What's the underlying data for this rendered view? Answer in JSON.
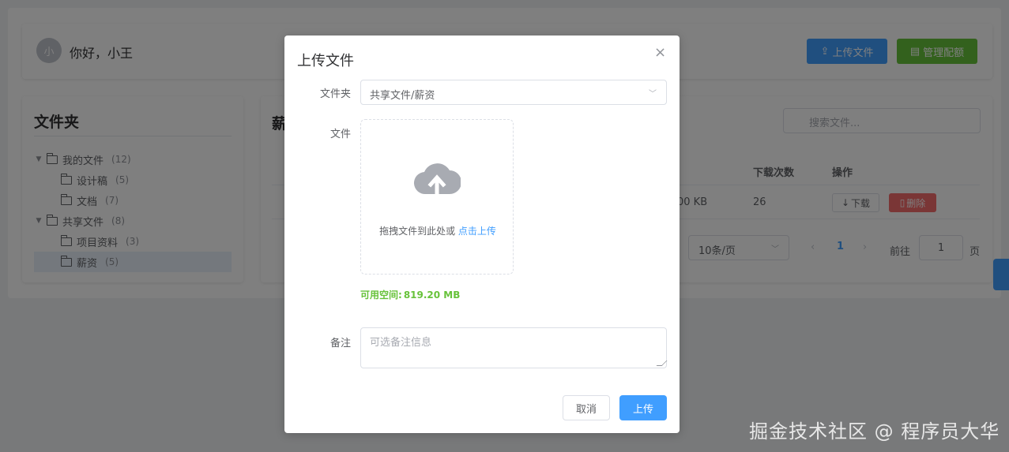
{
  "header": {
    "avatar_text": "小",
    "greeting": "你好，小王",
    "upload_button": "上传文件",
    "manage_button": "管理配额"
  },
  "sidebar": {
    "title": "文件夹",
    "tree": [
      {
        "label": "我的文件",
        "count": "(12)"
      },
      {
        "label": "设计稿",
        "count": "(5)"
      },
      {
        "label": "文档",
        "count": "(7)"
      },
      {
        "label": "共享文件",
        "count": "(8)"
      },
      {
        "label": "项目资料",
        "count": "(3)"
      },
      {
        "label": "薪资",
        "count": "(5)"
      }
    ]
  },
  "main": {
    "title": "薪",
    "search_placeholder": "搜索文件...",
    "columns": {
      "downloads": "下载次数",
      "actions": "操作"
    },
    "row": {
      "size": "00 KB",
      "downloads": "26",
      "download_btn": "下载",
      "delete_btn": "删除"
    },
    "pagination": {
      "page_size": "10条/页",
      "current_page": "1",
      "goto_label": "前往",
      "goto_value": "1",
      "goto_suffix": "页"
    }
  },
  "dialog": {
    "title": "上传文件",
    "close_symbol": "×",
    "folder_label": "文件夹",
    "folder_value": "共享文件/薪资",
    "file_label": "文件",
    "drop_text": "拖拽文件到此处或",
    "drop_link": "点击上传",
    "space_label": "可用空间:",
    "space_value": "819.20 MB",
    "note_label": "备注",
    "note_placeholder": "可选备注信息",
    "cancel_button": "取消",
    "submit_button": "上传"
  },
  "watermark": "掘金技术社区 @ 程序员大华",
  "colors": {
    "primary": "#409eff",
    "success": "#67c23a",
    "danger": "#f56c6c",
    "overlay": "rgba(0,0,0,0.5)"
  }
}
